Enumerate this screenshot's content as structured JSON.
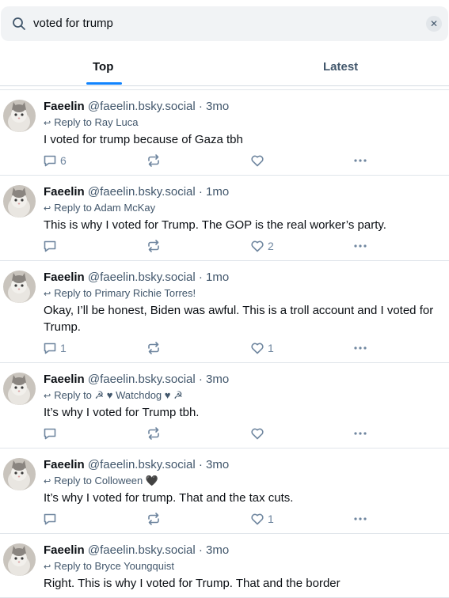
{
  "search": {
    "query": "voted for trump",
    "clear_label": "✕"
  },
  "tabs": [
    {
      "label": "Top"
    },
    {
      "label": "Latest"
    }
  ],
  "posts": [
    {
      "name": "Faeelin",
      "handle": "@faeelin.bsky.social",
      "time": "· 3mo",
      "reply_label": "Reply to Ray Luca",
      "text": "I voted for trump because of Gaza tbh",
      "replies": "6",
      "reposts": "",
      "likes": ""
    },
    {
      "name": "Faeelin",
      "handle": "@faeelin.bsky.social",
      "time": "· 1mo",
      "reply_label": "Reply to Adam McKay",
      "text": "This is why I voted for Trump. The GOP is  the real worker’s party.",
      "replies": "",
      "reposts": "",
      "likes": "2"
    },
    {
      "name": "Faeelin",
      "handle": "@faeelin.bsky.social",
      "time": "· 1mo",
      "reply_label": "Reply to Primary Richie Torres!",
      "text": "Okay, I’ll be honest, Biden was awful. This is a troll account and I voted for Trump.",
      "replies": "1",
      "reposts": "",
      "likes": "1"
    },
    {
      "name": "Faeelin",
      "handle": "@faeelin.bsky.social",
      "time": "· 3mo",
      "reply_label": "Reply to ☭ ♥ Watchdog ♥ ☭",
      "text": "It’s why I voted for Trump tbh.",
      "replies": "",
      "reposts": "",
      "likes": ""
    },
    {
      "name": "Faeelin",
      "handle": "@faeelin.bsky.social",
      "time": "· 3mo",
      "reply_label": "Reply to Colloween 🖤",
      "text": "It’s why I voted for trump. That and the tax cuts.",
      "replies": "",
      "reposts": "",
      "likes": "1"
    },
    {
      "name": "Faeelin",
      "handle": "@faeelin.bsky.social",
      "time": "· 3mo",
      "reply_label": "Reply to Bryce Youngquist",
      "text": "Right. This is why I voted for Trump. That and the border",
      "replies": "",
      "reposts": "",
      "likes": ""
    }
  ]
}
